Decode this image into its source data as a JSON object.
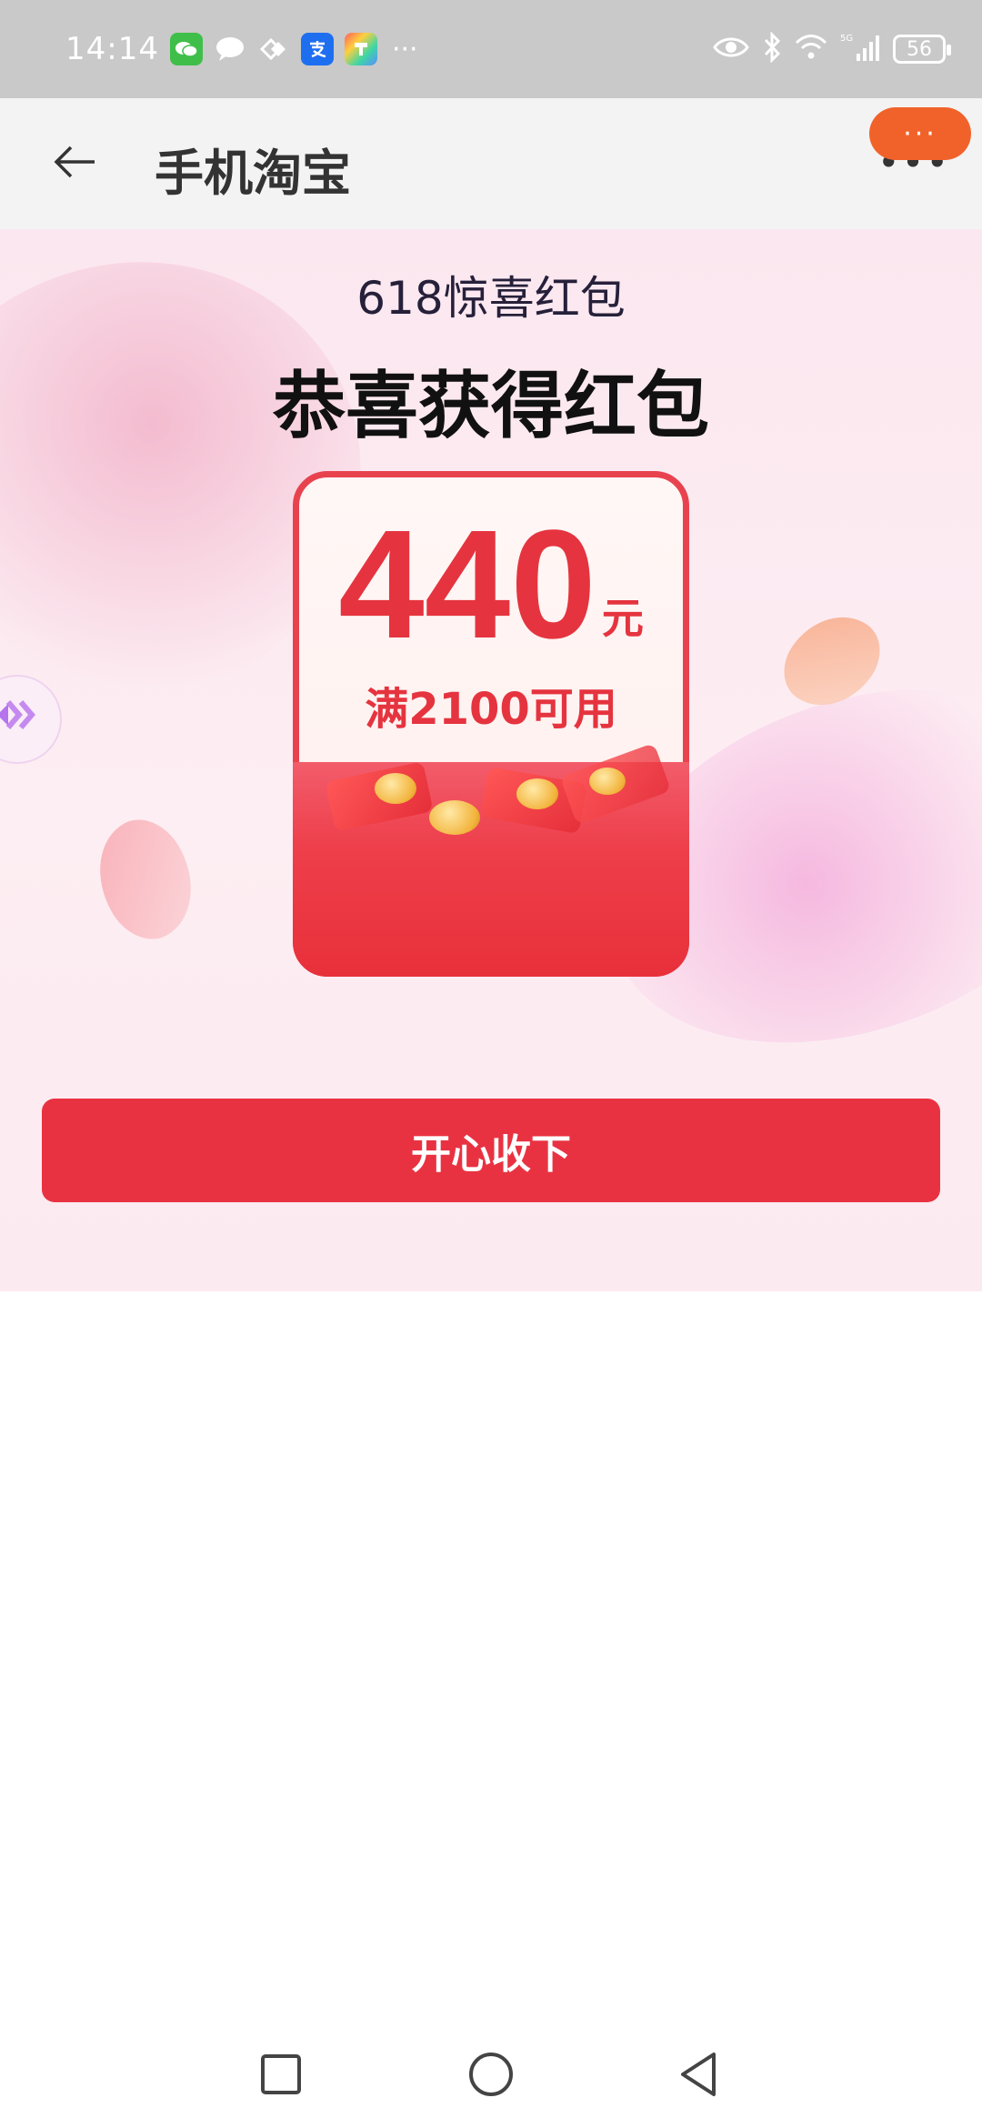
{
  "status_bar": {
    "time": "14:14",
    "more": "···",
    "battery": "56"
  },
  "header": {
    "title": "手机淘宝",
    "menu_label": "•••",
    "chat_badge": "···"
  },
  "promo": {
    "subtitle": "618惊喜红包",
    "title": "恭喜获得红包",
    "amount": "440",
    "unit": "元",
    "condition": "满2100可用",
    "accept_label": "开心收下"
  },
  "colors": {
    "accent": "#e93241",
    "packet_red": "#e5343f",
    "chat_badge": "#f1622a"
  },
  "icons": {
    "back": "arrow-left-icon",
    "menu": "more-dots-icon",
    "side_tab": "double-chevron-icon",
    "nav_recent": "square-icon",
    "nav_home": "circle-icon",
    "nav_back": "triangle-back-icon"
  }
}
